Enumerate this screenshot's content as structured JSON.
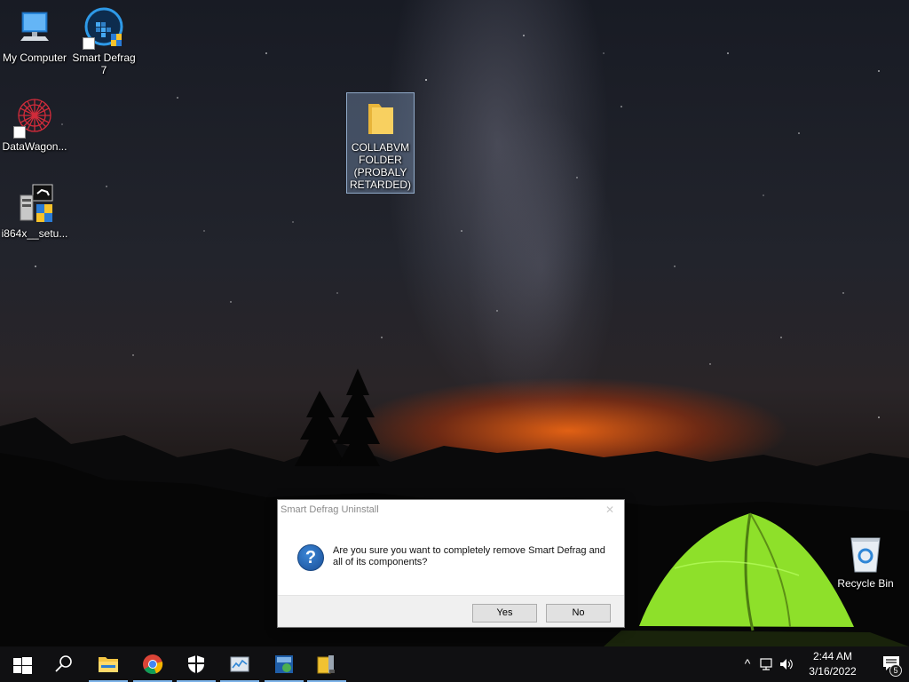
{
  "desktop": {
    "icons": [
      {
        "label": "My Computer",
        "icon": "computer-icon"
      },
      {
        "label": "Smart Defrag 7",
        "icon": "smart-defrag-icon"
      },
      {
        "label": "DataWagon...",
        "icon": "datawagon-icon"
      },
      {
        "label": "i864x__setu...",
        "icon": "installer-icon"
      },
      {
        "label": "COLLABVM FOLDER (PROBALY RETARDED)",
        "icon": "folder-icon"
      },
      {
        "label": "Recycle Bin",
        "icon": "recycle-bin-icon"
      }
    ]
  },
  "dialog": {
    "title": "Smart Defrag Uninstall",
    "close_label": "✕",
    "icon": "question-icon",
    "icon_glyph": "?",
    "message": "Are you sure you want to completely remove Smart Defrag and all of its components?",
    "yes_label": "Yes",
    "no_label": "No"
  },
  "taskbar": {
    "pinned": [
      {
        "name": "start",
        "icon": "windows-logo-icon"
      },
      {
        "name": "search",
        "icon": "search-icon"
      },
      {
        "name": "file-explorer",
        "icon": "file-explorer-icon",
        "running": true
      },
      {
        "name": "chrome",
        "icon": "chrome-icon",
        "running": true
      },
      {
        "name": "security",
        "icon": "shield-icon",
        "running": true
      },
      {
        "name": "task-manager",
        "icon": "chart-window-icon",
        "running": true
      },
      {
        "name": "boot-utility",
        "icon": "boot-utility-icon",
        "running": true
      },
      {
        "name": "uninstaller",
        "icon": "uninstaller-icon",
        "running": true
      }
    ],
    "tray": {
      "chevron": "^",
      "time": "2:44 AM",
      "date": "3/16/2022",
      "notification_count": "5"
    }
  },
  "colors": {
    "taskbar_bg": "#101012",
    "accent": "#1a4f98",
    "running_indicator": "#7eb4ea",
    "tent_green": "#8ee02a",
    "horizon_orange": "#eb6414"
  }
}
